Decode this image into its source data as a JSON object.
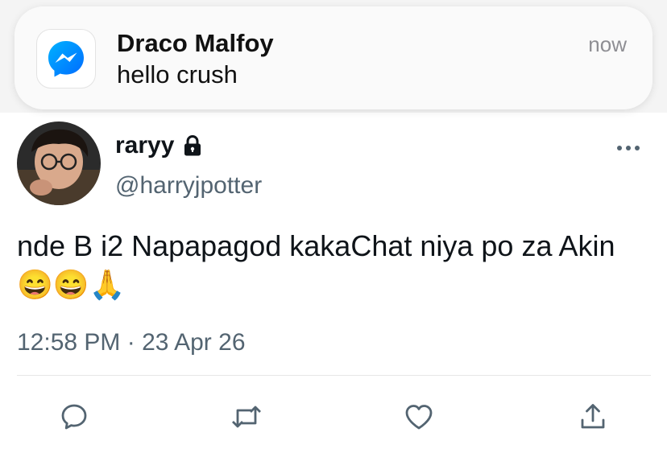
{
  "notification": {
    "app_icon": "messenger-icon",
    "sender": "Draco Malfoy",
    "message": "hello crush",
    "time": "now"
  },
  "tweet": {
    "display_name": "raryy",
    "protected_icon": "lock-icon",
    "handle": "@harryjpotter",
    "text": "nde B i2 Napapagod kakaChat niya po za Akin 😄😄🙏",
    "timestamp": "12:58 PM · 23 Apr 26"
  },
  "actions": {
    "icons": [
      "reply-icon",
      "retweet-icon",
      "like-icon",
      "share-icon"
    ]
  },
  "colors": {
    "messenger_gradient_start": "#00B2FF",
    "messenger_gradient_end": "#006AFF",
    "secondary_text": "#536471",
    "icon_gray": "#536471"
  }
}
